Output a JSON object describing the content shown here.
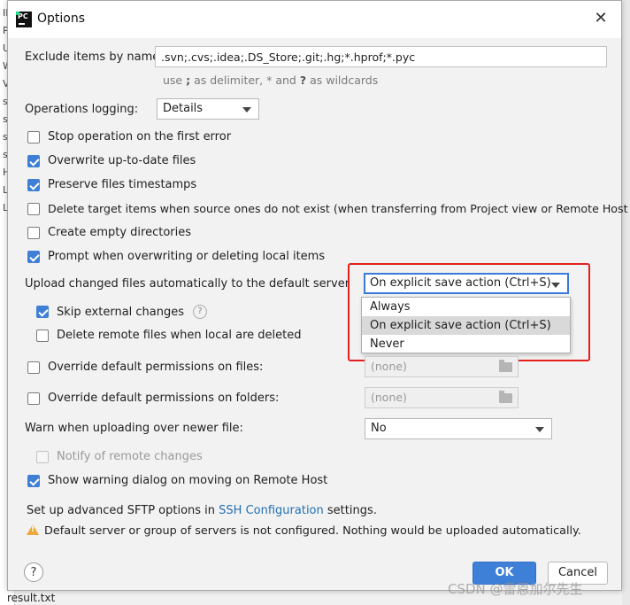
{
  "background": {
    "left_fragments": [
      "II",
      "P",
      "U",
      "W",
      "V",
      "su",
      "su",
      "su",
      "su",
      "H",
      "L",
      "L"
    ],
    "file_name": "result.txt"
  },
  "window": {
    "app_logo": "PC",
    "title": "Options",
    "close_glyph": "✕"
  },
  "exclude": {
    "label": "Exclude items by name:",
    "value": ".svn;.cvs;.idea;.DS_Store;.git;.hg;*.hprof;*.pyc",
    "hint_pre": "use ",
    "hint_sep": ";",
    "hint_mid": " as delimiter, * and ",
    "hint_q": "?",
    "hint_post": " as wildcards"
  },
  "operations_logging": {
    "label": "Operations logging:",
    "selected": "Details"
  },
  "checkboxes": [
    {
      "label": "Stop operation on the first error",
      "checked": false
    },
    {
      "label": "Overwrite up-to-date files",
      "checked": true
    },
    {
      "label": "Preserve files timestamps",
      "checked": true
    },
    {
      "label": "Delete target items when source ones do not exist (when transferring from Project view or Remote Host view)",
      "checked": false
    },
    {
      "label": "Create empty directories",
      "checked": false
    },
    {
      "label": "Prompt when overwriting or deleting local items",
      "checked": true
    }
  ],
  "upload": {
    "label": "Upload changed files automatically to the default server",
    "selected": "On explicit save action (Ctrl+S)",
    "options": [
      "Always",
      "On explicit save action (Ctrl+S)",
      "Never"
    ],
    "skip_external": {
      "label": "Skip external changes",
      "checked": true
    },
    "delete_remote": {
      "label": "Delete remote files when local are deleted",
      "checked": false
    }
  },
  "permissions": {
    "files_label": "Override default permissions on files:",
    "files_value": "(none)",
    "folders_label": "Override default permissions on folders:",
    "folders_value": "(none)"
  },
  "warn_newer": {
    "label": "Warn when uploading over newer file:",
    "selected": "No"
  },
  "notify_remote": {
    "label": "Notify of remote changes",
    "checked": false,
    "disabled": true
  },
  "show_warning": {
    "label": "Show warning dialog on moving on Remote Host",
    "checked": true
  },
  "sftp": {
    "prefix": "Set up advanced SFTP options in ",
    "link": "SSH Configuration",
    "suffix": " settings."
  },
  "warning_message": "Default server or group of servers is not configured. Nothing would be uploaded automatically.",
  "buttons": {
    "help": "?",
    "ok": "OK",
    "cancel": "Cancel"
  },
  "watermark": "CSDN @雷恩加尔先生",
  "colors": {
    "accent": "#3e7fd8",
    "highlight_box": "#e4201f",
    "link": "#2470b3",
    "warning": "#e8a93a"
  }
}
